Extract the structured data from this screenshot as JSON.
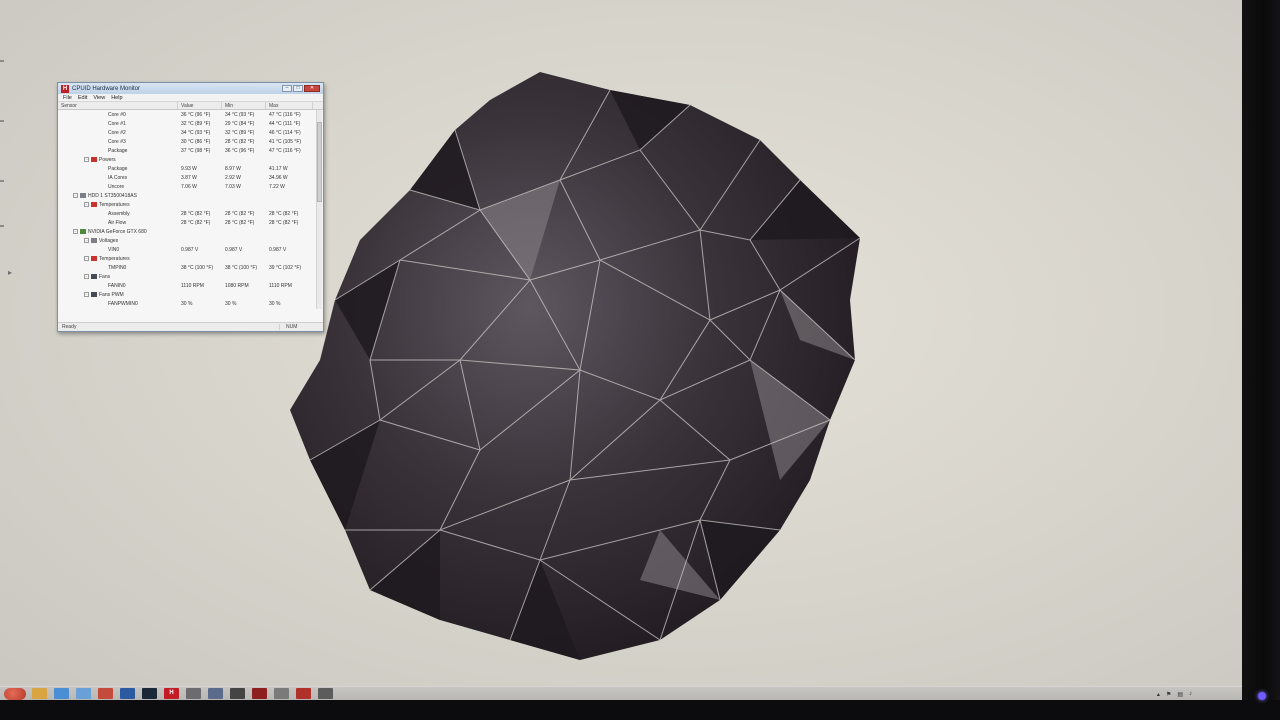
{
  "window": {
    "title": "CPUID Hardware Monitor",
    "app_icon_letter": "H",
    "menu": [
      "File",
      "Edit",
      "View",
      "Help"
    ],
    "columns": {
      "sensor": "Sensor",
      "value": "Value",
      "min": "Min",
      "max": "Max"
    },
    "rows": [
      {
        "name": "Core #0",
        "level": 3,
        "value": "36 °C (96 °F)",
        "min": "34 °C (93 °F)",
        "max": "47 °C (116 °F)"
      },
      {
        "name": "Core #1",
        "level": 3,
        "value": "32 °C (89 °F)",
        "min": "29 °C (84 °F)",
        "max": "44 °C (111 °F)"
      },
      {
        "name": "Core #2",
        "level": 3,
        "value": "34 °C (93 °F)",
        "min": "32 °C (89 °F)",
        "max": "46 °C (114 °F)"
      },
      {
        "name": "Core #3",
        "level": 3,
        "value": "30 °C (86 °F)",
        "min": "28 °C (82 °F)",
        "max": "41 °C (105 °F)"
      },
      {
        "name": "Package",
        "level": 3,
        "value": "37 °C (98 °F)",
        "min": "36 °C (96 °F)",
        "max": "47 °C (116 °F)"
      },
      {
        "name": "Powers",
        "level": 2,
        "group": true,
        "icon": "power-icon",
        "value": "",
        "min": "",
        "max": ""
      },
      {
        "name": "Package",
        "level": 3,
        "value": "9.93 W",
        "min": "8.97 W",
        "max": "41.17 W"
      },
      {
        "name": "IA Cores",
        "level": 3,
        "value": "3.87 W",
        "min": "2.92 W",
        "max": "34.96 W"
      },
      {
        "name": "Uncore",
        "level": 3,
        "value": "7.06 W",
        "min": "7.03 W",
        "max": "7.22 W"
      },
      {
        "name": "HDD 1 ST3500418AS",
        "level": 1,
        "group": true,
        "icon": "hdd-icon",
        "value": "",
        "min": "",
        "max": ""
      },
      {
        "name": "Temperatures",
        "level": 2,
        "group": true,
        "icon": "thermometer-icon",
        "value": "",
        "min": "",
        "max": ""
      },
      {
        "name": "Assembly",
        "level": 3,
        "value": "28 °C (82 °F)",
        "min": "28 °C (82 °F)",
        "max": "28 °C (82 °F)"
      },
      {
        "name": "Air Flow",
        "level": 3,
        "value": "28 °C (82 °F)",
        "min": "28 °C (82 °F)",
        "max": "28 °C (82 °F)"
      },
      {
        "name": "NVIDIA GeForce GTX 680",
        "level": 1,
        "group": true,
        "icon": "gpu-icon",
        "value": "",
        "min": "",
        "max": ""
      },
      {
        "name": "Voltages",
        "level": 2,
        "group": true,
        "icon": "voltage-icon",
        "value": "",
        "min": "",
        "max": ""
      },
      {
        "name": "VIN0",
        "level": 3,
        "value": "0.987 V",
        "min": "0.987 V",
        "max": "0.987 V"
      },
      {
        "name": "Temperatures",
        "level": 2,
        "group": true,
        "icon": "thermometer-icon",
        "value": "",
        "min": "",
        "max": ""
      },
      {
        "name": "TMPIN0",
        "level": 3,
        "value": "38 °C (100 °F)",
        "min": "38 °C (100 °F)",
        "max": "39 °C (102 °F)"
      },
      {
        "name": "Fans",
        "level": 2,
        "group": true,
        "icon": "fan-icon",
        "value": "",
        "min": "",
        "max": ""
      },
      {
        "name": "FANIN0",
        "level": 3,
        "value": "1110 RPM",
        "min": "1080 RPM",
        "max": "1110 RPM"
      },
      {
        "name": "Fans PWM",
        "level": 2,
        "group": true,
        "icon": "fan-pwm-icon",
        "value": "",
        "min": "",
        "max": ""
      },
      {
        "name": "FANPWMIN0",
        "level": 3,
        "value": "30 %",
        "min": "30 %",
        "max": "30 %"
      }
    ],
    "status": {
      "left": "Ready",
      "right": "NUM"
    }
  },
  "taskbar": {
    "items": [
      {
        "name": "explorer-icon",
        "color": "#d9a441",
        "label": ""
      },
      {
        "name": "ie-icon",
        "color": "#4a8fd4",
        "label": ""
      },
      {
        "name": "mediaplayer-icon",
        "color": "#6aa0d8",
        "label": ""
      },
      {
        "name": "chrome-icon",
        "color": "#c44b3c",
        "label": ""
      },
      {
        "name": "word-icon",
        "color": "#2c5aa0",
        "label": ""
      },
      {
        "name": "steam-icon",
        "color": "#1b2838",
        "label": ""
      },
      {
        "name": "hwmonitor-icon",
        "color": "#c41c24",
        "label": "H"
      },
      {
        "name": "settings-icon",
        "color": "#6b6b70",
        "label": ""
      },
      {
        "name": "app-icon-1",
        "color": "#5a6b8c",
        "label": ""
      },
      {
        "name": "app-icon-2",
        "color": "#444444",
        "label": ""
      },
      {
        "name": "app-icon-3",
        "color": "#8e1f1f",
        "label": ""
      },
      {
        "name": "app-icon-4",
        "color": "#7a7a7a",
        "label": ""
      },
      {
        "name": "app-icon-5",
        "color": "#b0302a",
        "label": ""
      },
      {
        "name": "app-icon-6",
        "color": "#5c5c5c",
        "label": ""
      }
    ]
  },
  "colors": {
    "desktop": "#dcd9d0",
    "accent": "#c41c24",
    "led": "#6d5cff"
  }
}
